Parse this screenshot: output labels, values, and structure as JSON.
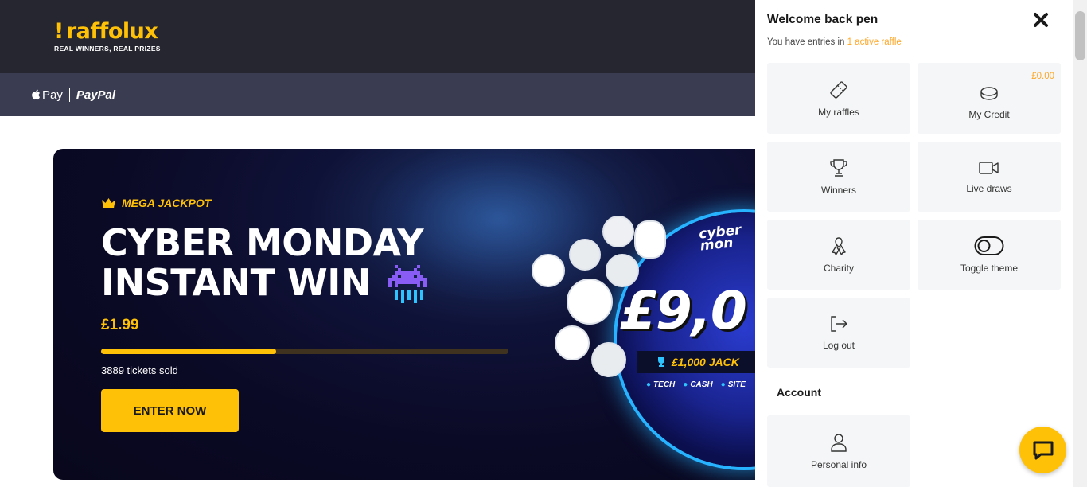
{
  "header": {
    "logo_text": "raffolux",
    "logo_tagline": "REAL WINNERS, REAL PRIZES"
  },
  "payments": {
    "apple_pay": "Pay",
    "paypal": "PayPal"
  },
  "hero": {
    "badge": "MEGA JACKPOT",
    "title_line1": "CYBER MONDAY",
    "title_line2": "INSTANT WIN",
    "price": "£1.99",
    "progress_fraction": 0.43,
    "tickets_sold": "3889 tickets sold",
    "cta": "ENTER NOW",
    "graphic_brand": "cyber mon",
    "graphic_amount": "£9,0",
    "graphic_jackpot": "£1,000 JACK",
    "graphic_tags": [
      "TECH",
      "CASH",
      "SITE"
    ]
  },
  "panel": {
    "title": "Welcome back pen",
    "subtitle_prefix": "You have entries in ",
    "subtitle_link": "1 active raffle",
    "tiles": {
      "my_raffles": "My raffles",
      "my_credit": "My Credit",
      "credit_amount": "£0.00",
      "winners": "Winners",
      "live_draws": "Live draws",
      "charity": "Charity",
      "toggle_theme": "Toggle theme",
      "log_out": "Log out"
    },
    "account_heading": "Account",
    "personal_info": "Personal info"
  },
  "colors": {
    "brand_yellow": "#ffc107",
    "header_dark": "#262630",
    "paybar": "#3a3d52",
    "accent_link": "#ffa726"
  },
  "icons": [
    "ticket-icon",
    "coin-icon",
    "trophy-icon",
    "video-camera-icon",
    "ribbon-icon",
    "toggle-icon",
    "logout-icon",
    "user-icon",
    "close-icon",
    "chat-icon",
    "crown-icon",
    "space-invader-icon",
    "apple-icon"
  ]
}
